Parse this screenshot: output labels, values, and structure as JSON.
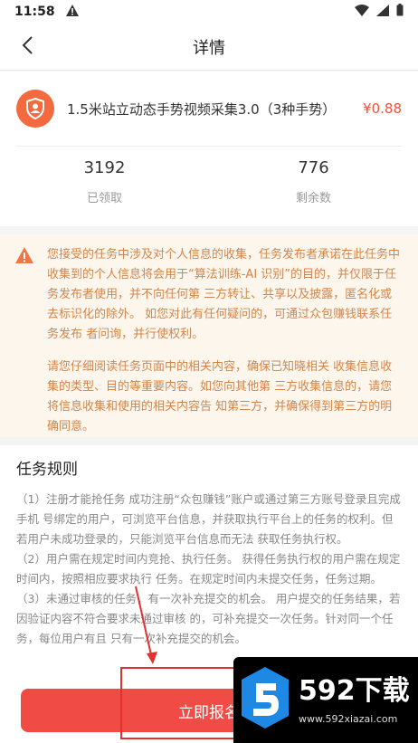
{
  "status_bar": {
    "time": "11:58"
  },
  "nav": {
    "title": "详情"
  },
  "task": {
    "name": "1.5米站立动态手势视频采集3.0（3种手势）",
    "price": "¥0.88",
    "stats": [
      {
        "value": "3192",
        "label": "已领取"
      },
      {
        "value": "776",
        "label": "剩余数"
      }
    ]
  },
  "notice": {
    "paragraph1": "您接受的任务中涉及对个人信息的收集，任务发布者承诺在此任务中收集到的个人信息将会用于“算法训练-AI 识别”的目的，并仅限于任务发布者使用，并不向任何第 三方转让、共享以及披露，匿名化或去标识化的除外。 如您对此有任何疑问的，可通过众包赚钱联系任务发布 者问询，并行使权利。",
    "paragraph2": "请您仔细阅读任务页面中的相关内容，确保已知晓相关 收集信息收集的类型、目的等重要内容。如您向其他第 三方收集信息的，请您将信息收集和使用的相关内容告 知第三方，并确保得到第三方的明确同意。"
  },
  "rules": {
    "title": "任务规则",
    "body": "（1）注册才能抢任务 成功注册“众包赚钱”账户或通过第三方账号登录且完成手机 号绑定的用户，可浏览平台信息，并获取执行平台上的任务的权利。但若用户未成功登录的，只能浏览平台信息而无法 获取任务执行权。\n（2）用户需在规定时间内竞抢、执行任务。 获得任务执行权的用户需在规定时间内，按照相应要求执行 任务。在规定时间内未提交任务，任务过期。\n（3）未通过审核的任务，有一次补充提交的机会。 用户提交的任务结果，若因验证内容不符合要求未通过审核 的，可补充提交一次任务。针对同一个任务，每位用户有且 只有一次补充提交的机会。"
  },
  "bottom": {
    "join_label": "立即报名"
  },
  "watermark": {
    "brand": "592下载",
    "url": "www.592xiazai.com"
  },
  "colors": {
    "accent": "#f04b45",
    "price": "#f0523a",
    "notice_bg": "#fdf6ed",
    "notice_text": "#d2854a",
    "task_icon": "#f26a3d"
  }
}
